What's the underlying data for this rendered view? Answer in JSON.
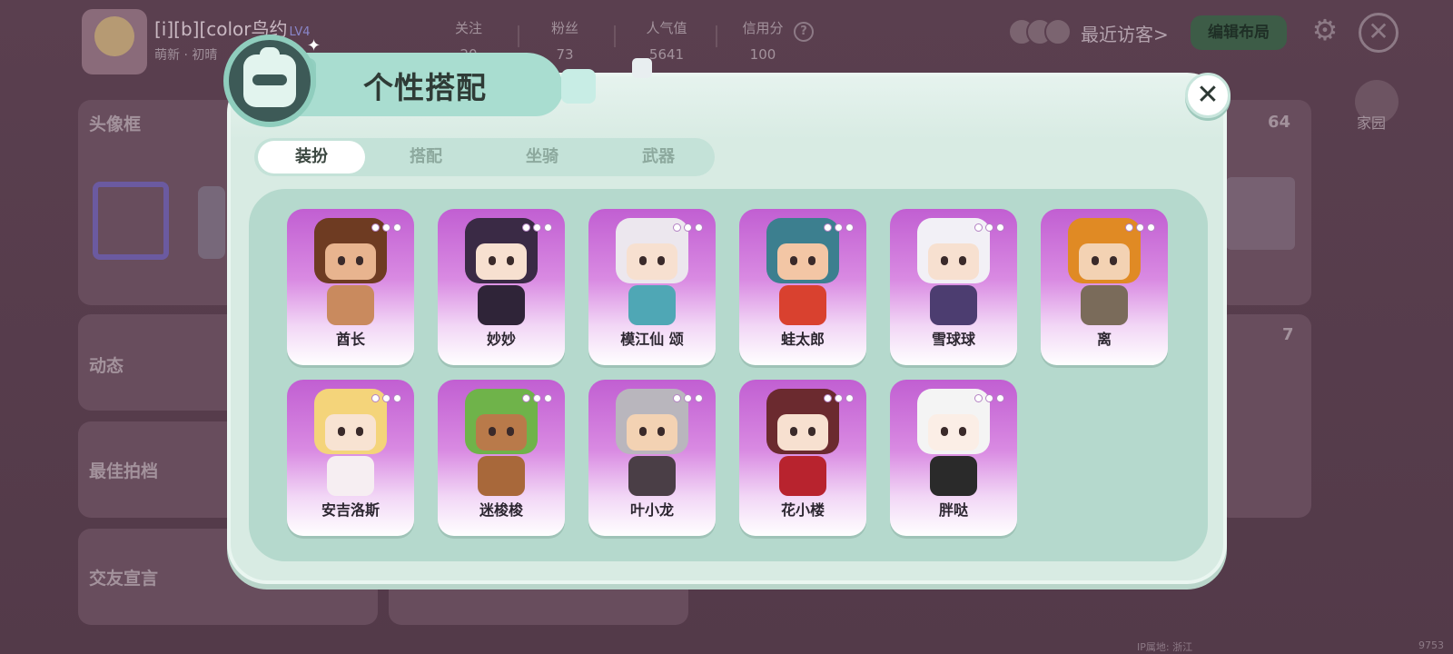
{
  "background": {
    "username": "[i][b][color鸟约",
    "level": "LV4",
    "sub_text": "萌新 · 初晴",
    "stats": [
      {
        "label": "关注",
        "value": "20"
      },
      {
        "label": "粉丝",
        "value": "73"
      },
      {
        "label": "人气值",
        "value": "5641"
      },
      {
        "label": "信用分",
        "value": "100"
      }
    ],
    "help_icon": "?",
    "recent_visitors": "最近访客>",
    "edit_layout": "编辑布局",
    "gear_icon": "⚙",
    "close_icon": "✕",
    "home_label": "家园",
    "cards": [
      {
        "title": "头像框"
      },
      {
        "title": "动态"
      },
      {
        "title": "最佳拍档"
      },
      {
        "title": "交友宣言"
      }
    ],
    "right_counts": [
      "64",
      "7"
    ],
    "footer_ip": "IP属地: 浙江",
    "footer_num": "9753"
  },
  "modal": {
    "title": "个性搭配",
    "close_icon": "✕",
    "sparkle_icon": "✦",
    "tabs": [
      {
        "label": "装扮",
        "active": true
      },
      {
        "label": "搭配",
        "active": false
      },
      {
        "label": "坐骑",
        "active": false
      },
      {
        "label": "武器",
        "active": false
      }
    ],
    "characters": [
      {
        "name": "酋长",
        "hair": "#6e3b22",
        "body": "#c98a5e",
        "face": "#e8b48f"
      },
      {
        "name": "妙妙",
        "hair": "#3a2a45",
        "body": "#2f2438",
        "face": "#f7e0d0"
      },
      {
        "name": "模江仙 颂",
        "hair": "#ece7ee",
        "body": "#4fa7b5",
        "face": "#f7e0d0"
      },
      {
        "name": "蛙太郎",
        "hair": "#3c7f8f",
        "body": "#d9412f",
        "face": "#f3c6a5"
      },
      {
        "name": "雪球球",
        "hair": "#f2f0f6",
        "body": "#4c3d70",
        "face": "#f7e0d0"
      },
      {
        "name": "离",
        "hair": "#e08a24",
        "body": "#7a6b5a",
        "face": "#f3d2b3"
      },
      {
        "name": "安吉洛斯",
        "hair": "#f4d47a",
        "body": "#f6eef2",
        "face": "#f8e3d2"
      },
      {
        "name": "迷梭梭",
        "hair": "#6fb34a",
        "body": "#a8683a",
        "face": "#b97a4a"
      },
      {
        "name": "叶小龙",
        "hair": "#b9b6bd",
        "body": "#4a3e46",
        "face": "#f3d2b3"
      },
      {
        "name": "花小楼",
        "hair": "#6b2a2f",
        "body": "#b8232e",
        "face": "#f7e0d0"
      },
      {
        "name": "胖哒",
        "hair": "#f4f4f4",
        "body": "#2a2a2a",
        "face": "#fbeee6"
      }
    ]
  }
}
